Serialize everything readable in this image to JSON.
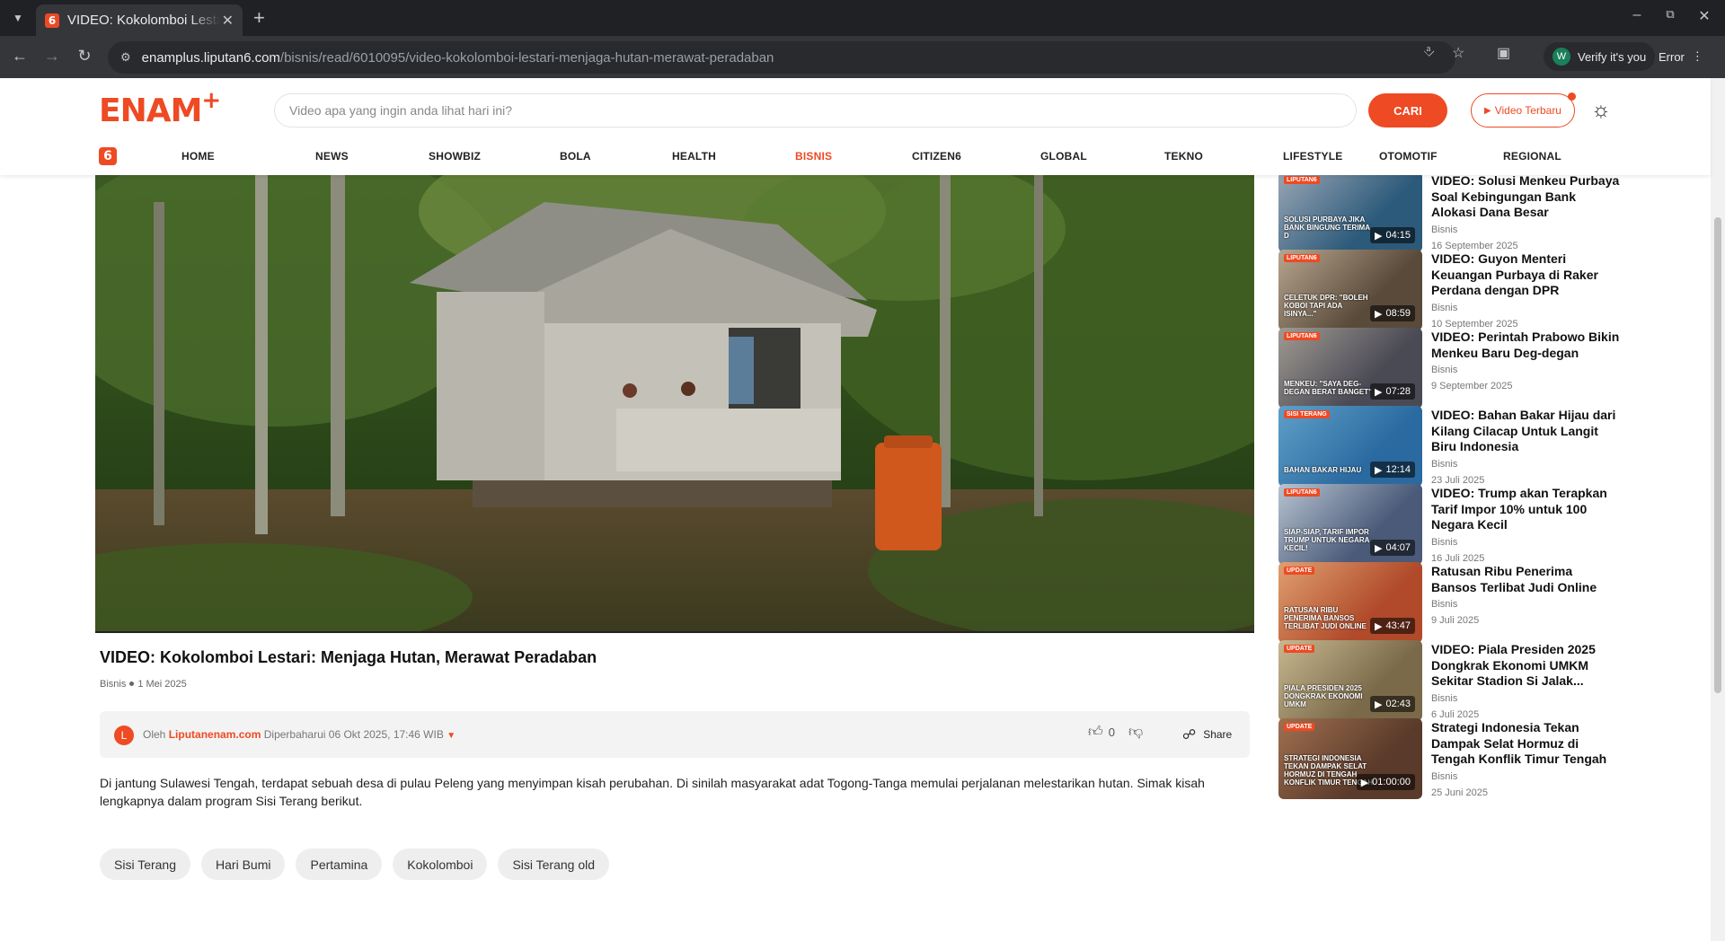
{
  "browser": {
    "tab_title": "VIDEO: Kokolomboi Lestari: Menjaga Hutan, Merawat Peradaban",
    "favicon": "6",
    "url_host": "enamplus.liputan6.com",
    "url_path": "/bisnis/read/6010095/video-kokolomboi-lestari-menjaga-hutan-merawat-peradaban",
    "profile_initial": "W",
    "profile_label": "Verify it's you",
    "error_label": "Error"
  },
  "header": {
    "logo": "ENAM",
    "logo_plus": "+",
    "search_placeholder": "Video apa yang ingin anda lihat hari ini?",
    "search_button": "CARI",
    "video_terbaru": "Video Terbaru",
    "accent_color": "#ee4a23"
  },
  "nav": {
    "badge": "6",
    "items": [
      "HOME",
      "NEWS",
      "SHOWBIZ",
      "BOLA",
      "HEALTH",
      "BISNIS",
      "CITIZEN6",
      "GLOBAL",
      "TEKNO",
      "LIFESTYLE",
      "OTOMOTIF",
      "REGIONAL"
    ],
    "active": "BISNIS"
  },
  "article": {
    "title": "VIDEO: Kokolomboi Lestari: Menjaga Hutan, Merawat Peradaban",
    "category": "Bisnis",
    "date": "1 Mei 2025",
    "author_initial": "L",
    "author_prefix": "Oleh",
    "author": "Liputanenam.com",
    "updated": "Diperbaharui 06 Okt 2025, 17:46 WIB",
    "likes": "0",
    "share_label": "Share",
    "description": "Di jantung Sulawesi Tengah, terdapat sebuah desa di pulau Peleng yang menyimpan kisah perubahan. Di sinilah masyarakat adat Togong-Tanga memulai perjalanan melestarikan hutan. Simak kisah lengkapnya dalam program Sisi Terang berikut.",
    "tags": [
      "Sisi Terang",
      "Hari Bumi",
      "Pertamina",
      "Kokolomboi",
      "Sisi Terang old"
    ]
  },
  "sidebar": {
    "items": [
      {
        "title": "VIDEO: Solusi Menkeu Purbaya Soal Kebingungan Bank Alokasi Dana Besar",
        "category": "Bisnis",
        "date": "16 September 2025",
        "duration": "04:15",
        "caption": "SOLUSI PURBAYA JIKA BANK BINGUNG TERIMA D",
        "brand": "LIPUTAN6"
      },
      {
        "title": "VIDEO: Guyon Menteri Keuangan Purbaya di Raker Perdana dengan DPR",
        "category": "Bisnis",
        "date": "10 September 2025",
        "duration": "08:59",
        "caption": "CELETUK DPR: \"BOLEH KOBOI TAPI ADA ISINYA...\"",
        "brand": "LIPUTAN6"
      },
      {
        "title": "VIDEO: Perintah Prabowo Bikin Menkeu Baru Deg-degan",
        "category": "Bisnis",
        "date": "9 September 2025",
        "duration": "07:28",
        "caption": "MENKEU: \"SAYA DEG-DEGAN BERAT BANGET\"",
        "brand": "LIPUTAN6"
      },
      {
        "title": "VIDEO: Bahan Bakar Hijau dari Kilang Cilacap Untuk Langit Biru Indonesia",
        "category": "Bisnis",
        "date": "23 Juli 2025",
        "duration": "12:14",
        "caption": "BAHAN BAKAR HIJAU",
        "brand": "SISI TERANG"
      },
      {
        "title": "VIDEO: Trump akan Terapkan Tarif Impor 10% untuk 100 Negara Kecil",
        "category": "Bisnis",
        "date": "16 Juli 2025",
        "duration": "04:07",
        "caption": "SIAP-SIAP, TARIF IMPOR TRUMP UNTUK NEGARA KECIL!",
        "brand": "LIPUTAN6"
      },
      {
        "title": "Ratusan Ribu Penerima Bansos Terlibat Judi Online",
        "category": "Bisnis",
        "date": "9 Juli 2025",
        "duration": "43:47",
        "caption": "RATUSAN RIBU PENERIMA BANSOS TERLIBAT JUDI ONLINE",
        "brand": "UPDATE"
      },
      {
        "title": "VIDEO: Piala Presiden 2025 Dongkrak Ekonomi UMKM Sekitar Stadion Si Jalak...",
        "category": "Bisnis",
        "date": "6 Juli 2025",
        "duration": "02:43",
        "caption": "PIALA PRESIDEN 2025 DONGKRAK EKONOMI UMKM",
        "brand": "UPDATE"
      },
      {
        "title": "Strategi Indonesia Tekan Dampak Selat Hormuz di Tengah Konflik Timur Tengah",
        "category": "Bisnis",
        "date": "25 Juni 2025",
        "duration": "01:00:00",
        "caption": "STRATEGI INDONESIA TEKAN DAMPAK SELAT HORMUZ DI TENGAH KONFLIK TIMUR TENGAH",
        "brand": "UPDATE"
      }
    ]
  }
}
